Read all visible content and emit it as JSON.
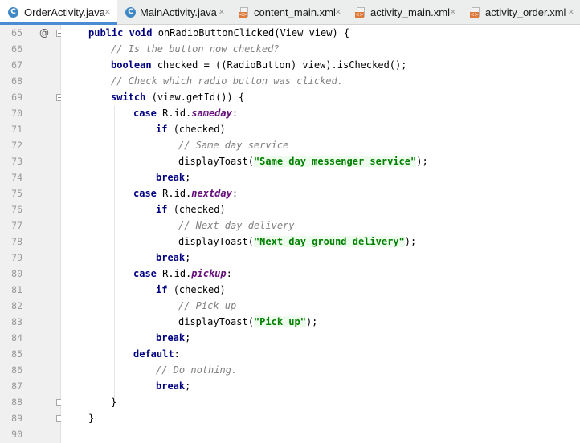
{
  "tabs": [
    {
      "label": "OrderActivity.java",
      "icon": "java-class-icon",
      "active": true
    },
    {
      "label": "MainActivity.java",
      "icon": "java-class-icon",
      "active": false
    },
    {
      "label": "content_main.xml",
      "icon": "xml-file-icon",
      "active": false
    },
    {
      "label": "activity_main.xml",
      "icon": "xml-file-icon",
      "active": false
    },
    {
      "label": "activity_order.xml",
      "icon": "xml-file-icon",
      "active": false
    }
  ],
  "tab_close_glyph": "×",
  "gutter": {
    "line_numbers": [
      "65",
      "66",
      "67",
      "68",
      "69",
      "70",
      "71",
      "72",
      "73",
      "74",
      "75",
      "76",
      "77",
      "78",
      "79",
      "80",
      "81",
      "82",
      "83",
      "84",
      "85",
      "86",
      "87",
      "88",
      "89",
      "90"
    ],
    "override_annotation": "@"
  },
  "code": {
    "l65": {
      "kw1": "public",
      "kw2": "void",
      "text": "onRadioButtonClicked(View view) {"
    },
    "l66": {
      "comment": "// Is the button now checked?"
    },
    "l67": {
      "kw": "boolean",
      "text": "checked = ((RadioButton) view).isChecked();"
    },
    "l68": {
      "comment": "// Check which radio button was clicked."
    },
    "l69": {
      "kw": "switch",
      "text": "(view.getId()) {"
    },
    "l70": {
      "kw": "case",
      "pre": "R.id.",
      "field": "sameday",
      "post": ":"
    },
    "l71": {
      "kw": "if",
      "text": "(checked)"
    },
    "l72": {
      "comment": "// Same day service"
    },
    "l73": {
      "pre": "displayToast(",
      "str": "\"Same day messenger service\"",
      "post": ");"
    },
    "l74": {
      "kw": "break",
      "post": ";"
    },
    "l75": {
      "kw": "case",
      "pre": "R.id.",
      "field": "nextday",
      "post": ":"
    },
    "l76": {
      "kw": "if",
      "text": "(checked)"
    },
    "l77": {
      "comment": "// Next day delivery"
    },
    "l78": {
      "pre": "displayToast(",
      "str": "\"Next day ground delivery\"",
      "post": ");"
    },
    "l79": {
      "kw": "break",
      "post": ";"
    },
    "l80": {
      "kw": "case",
      "pre": "R.id.",
      "field": "pickup",
      "post": ":"
    },
    "l81": {
      "kw": "if",
      "text": "(checked)"
    },
    "l82": {
      "comment": "// Pick up"
    },
    "l83": {
      "pre": "displayToast(",
      "str": "\"Pick up\"",
      "post": ");"
    },
    "l84": {
      "kw": "break",
      "post": ";"
    },
    "l85": {
      "kw": "default",
      "post": ":"
    },
    "l86": {
      "comment": "// Do nothing."
    },
    "l87": {
      "kw": "break",
      "post": ";"
    },
    "l88": {
      "text": "}"
    },
    "l89": {
      "text": "}"
    }
  },
  "colors": {
    "keyword": "#000080",
    "comment": "#808080",
    "string": "#008000",
    "string_bg": "#edfcec",
    "field": "#660e7a",
    "tab_active_underline": "#4a8bd4"
  }
}
